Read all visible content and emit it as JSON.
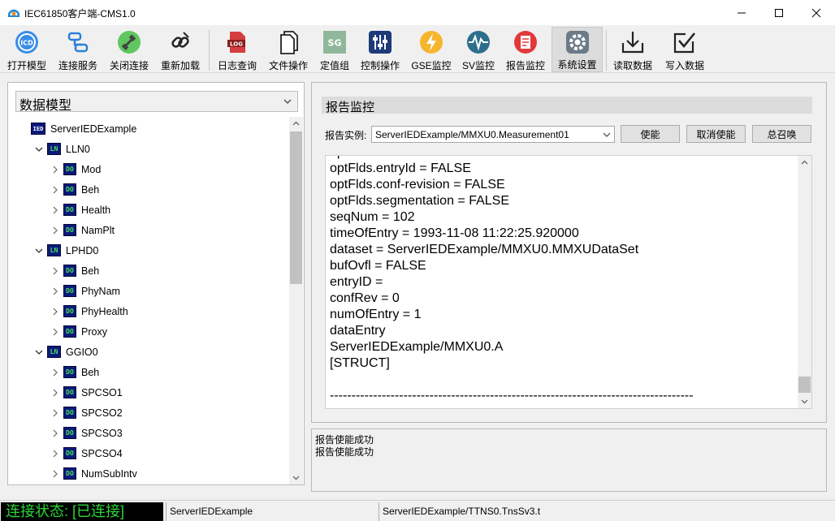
{
  "window": {
    "title": "IEC61850客户端-CMS1.0"
  },
  "toolbar": [
    {
      "label": "打开模型",
      "icon": "open-model-icon"
    },
    {
      "label": "连接服务",
      "icon": "connect-icon"
    },
    {
      "label": "关闭连接",
      "icon": "disconnect-icon"
    },
    {
      "label": "重新加载",
      "icon": "reload-icon"
    },
    {
      "label": "日志查询",
      "icon": "log-icon"
    },
    {
      "label": "文件操作",
      "icon": "file-icon"
    },
    {
      "label": "定值组",
      "icon": "setting-group-icon"
    },
    {
      "label": "控制操作",
      "icon": "control-icon"
    },
    {
      "label": "GSE监控",
      "icon": "gse-icon"
    },
    {
      "label": "SV监控",
      "icon": "sv-icon"
    },
    {
      "label": "报告监控",
      "icon": "report-icon"
    },
    {
      "label": "系统设置",
      "icon": "settings-icon"
    },
    {
      "label": "读取数据",
      "icon": "read-data-icon"
    },
    {
      "label": "写入数据",
      "icon": "write-data-icon"
    }
  ],
  "icons": {
    "log_text": "LOG",
    "sg_text": "SG",
    "icd_text": "ICD"
  },
  "left": {
    "model_select": "数据模型",
    "tree": [
      {
        "label": "ServerIEDExample",
        "type": "IED",
        "badge": "IED",
        "level": 0,
        "expanded": true
      },
      {
        "label": "LLN0",
        "type": "LN",
        "badge": "LN",
        "level": 1,
        "expanded": true
      },
      {
        "label": "Mod",
        "type": "DO",
        "badge": "DO",
        "level": 2,
        "expanded": false
      },
      {
        "label": "Beh",
        "type": "DO",
        "badge": "DO",
        "level": 2,
        "expanded": false
      },
      {
        "label": "Health",
        "type": "DO",
        "badge": "DO",
        "level": 2,
        "expanded": false
      },
      {
        "label": "NamPlt",
        "type": "DO",
        "badge": "DO",
        "level": 2,
        "expanded": false
      },
      {
        "label": "LPHD0",
        "type": "LN",
        "badge": "LN",
        "level": 1,
        "expanded": true
      },
      {
        "label": "Beh",
        "type": "DO",
        "badge": "DO",
        "level": 2,
        "expanded": false
      },
      {
        "label": "PhyNam",
        "type": "DO",
        "badge": "DO",
        "level": 2,
        "expanded": false
      },
      {
        "label": "PhyHealth",
        "type": "DO",
        "badge": "DO",
        "level": 2,
        "expanded": false
      },
      {
        "label": "Proxy",
        "type": "DO",
        "badge": "DO",
        "level": 2,
        "expanded": false
      },
      {
        "label": "GGIO0",
        "type": "LN",
        "badge": "LN",
        "level": 1,
        "expanded": true
      },
      {
        "label": "Beh",
        "type": "DO",
        "badge": "DO",
        "level": 2,
        "expanded": false
      },
      {
        "label": "SPCSO1",
        "type": "DO",
        "badge": "DO",
        "level": 2,
        "expanded": false
      },
      {
        "label": "SPCSO2",
        "type": "DO",
        "badge": "DO",
        "level": 2,
        "expanded": false
      },
      {
        "label": "SPCSO3",
        "type": "DO",
        "badge": "DO",
        "level": 2,
        "expanded": false
      },
      {
        "label": "SPCSO4",
        "type": "DO",
        "badge": "DO",
        "level": 2,
        "expanded": false
      },
      {
        "label": "NumSubIntv",
        "type": "DO",
        "badge": "DO",
        "level": 2,
        "expanded": false
      }
    ]
  },
  "right": {
    "header": "报告监控",
    "instance_label": "报告实例:",
    "instance_value": "ServerIEDExample/MMXU0.Measurement01",
    "btn_enable": "使能",
    "btn_disable": "取消使能",
    "btn_gi": "总召唤",
    "report_lines": [
      "optFlds.buffer-overflow = FALSE",
      "optFlds.entryId = FALSE",
      "optFlds.conf-revision = FALSE",
      "optFlds.segmentation = FALSE",
      "seqNum = 102",
      "timeOfEntry = 1993-11-08 11:22:25.920000",
      "dataset = ServerIEDExample/MMXU0.MMXUDataSet",
      "bufOvfl = FALSE",
      "entryID =",
      "confRev = 0",
      "numOfEntry = 1",
      "dataEntry",
      "ServerIEDExample/MMXU0.A",
      "[STRUCT]",
      "",
      "------------------------------------------------------------------------------------"
    ]
  },
  "log": {
    "lines": [
      "报告使能成功",
      "报告使能成功"
    ]
  },
  "status": {
    "connection": "连接状态: [已连接]",
    "server": "ServerIEDExample",
    "path": "ServerIEDExample/TTNS0.TnsSv3.t"
  },
  "colors": {
    "badge_bg": "#0b1a7a",
    "badge_fg": "#49e05a",
    "status_fg": "#2bd43a",
    "status_bg": "#000000"
  }
}
